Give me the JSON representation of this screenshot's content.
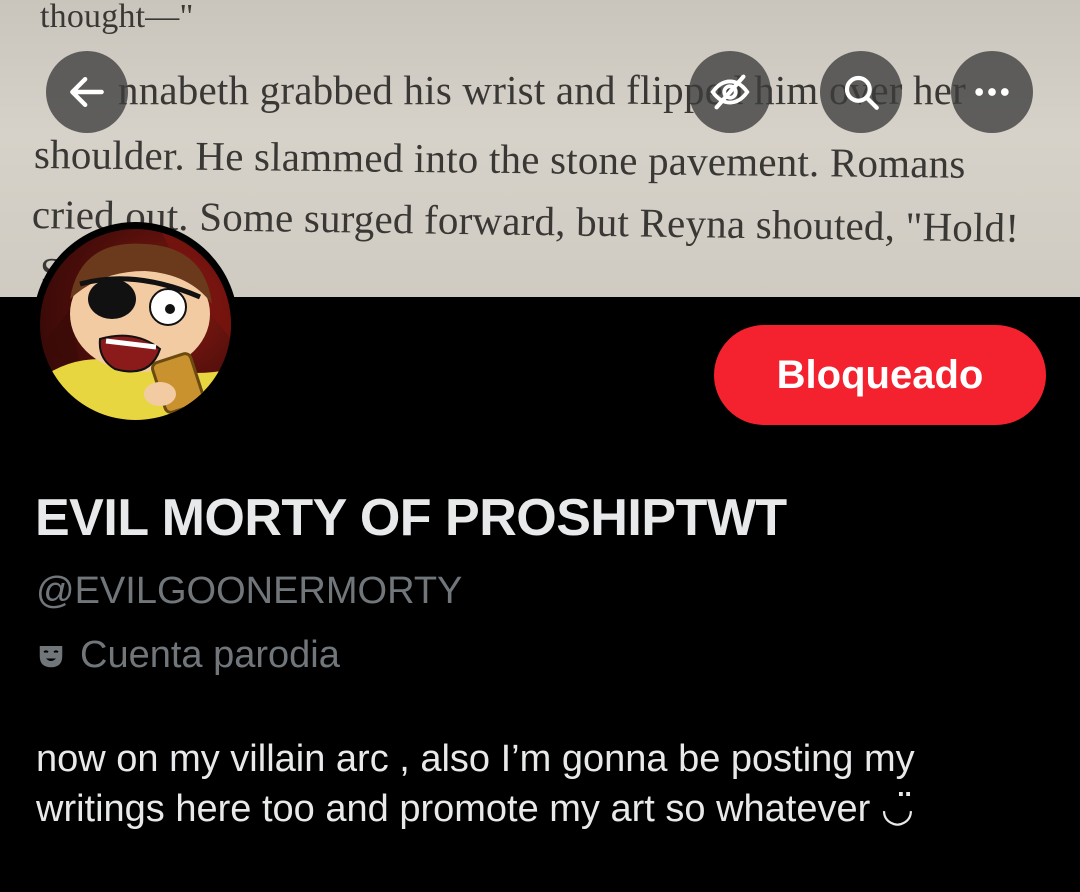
{
  "banner": {
    "book_lines": [
      "thought—\"",
      "nnabeth grabbed his wrist and  flipped  him  over  her",
      "shoulder. He slammed into the stone pavement. Romans",
      "cried out. Some surged forward, but Reyna shouted, \"Hold!",
      "S          !\""
    ]
  },
  "toolbar": {
    "back_icon": "arrow-left-icon",
    "offline_icon": "eye-slash-icon",
    "search_icon": "search-icon",
    "more_icon": "more-horizontal-icon"
  },
  "profile": {
    "block_label": "Bloqueado",
    "display_name": "EVIL MORTY OF PROSHIPTWT",
    "handle": "@EVILGOONERMORTY",
    "parody_label": "Cuenta parodia",
    "bio": "now on my villain arc , also I’m gonna be posting my writings here too and promote my art so whatever ◡̈"
  },
  "colors": {
    "block_button": "#f4212e",
    "secondary_text": "#71767b",
    "primary_text": "#e7e9ea"
  }
}
